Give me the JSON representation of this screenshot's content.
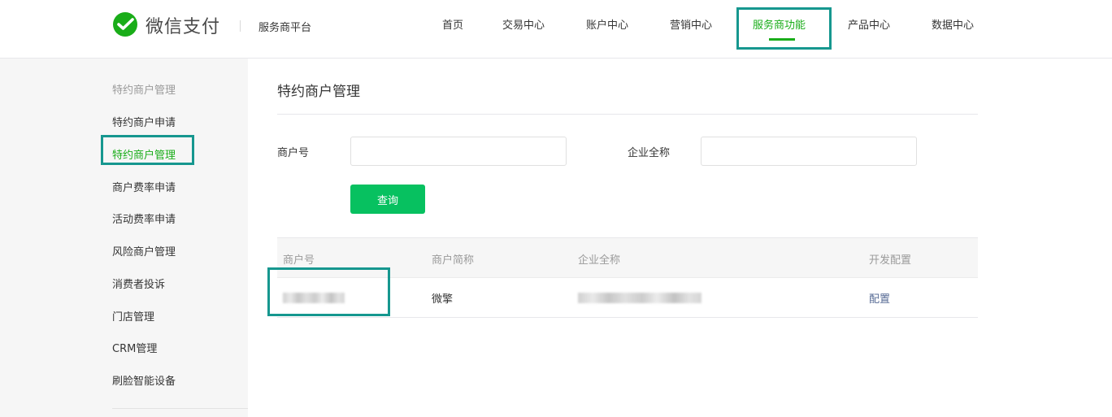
{
  "header": {
    "logo_text": "微信支付",
    "platform": "服务商平台",
    "nav": [
      "首页",
      "交易中心",
      "账户中心",
      "营销中心",
      "服务商功能",
      "产品中心",
      "数据中心"
    ],
    "active_nav": "服务商功能"
  },
  "sidebar": {
    "section_title": "特约商户管理",
    "items": [
      "特约商户申请",
      "特约商户管理",
      "商户费率申请",
      "活动费率申请",
      "风险商户管理",
      "消费者投诉",
      "门店管理",
      "CRM管理",
      "刷脸智能设备"
    ],
    "active_item": "特约商户管理"
  },
  "main": {
    "title": "特约商户管理",
    "form": {
      "merchant_no_label": "商户号",
      "merchant_no_value": "",
      "company_label": "企业全称",
      "company_value": "",
      "query_button": "查询"
    },
    "table": {
      "columns": [
        "商户号",
        "商户简称",
        "企业全称",
        "开发配置"
      ],
      "rows": [
        {
          "short_name": "微擎",
          "action": "配置"
        }
      ]
    }
  },
  "colors": {
    "brand_green": "#1aad19",
    "button_green": "#07c160",
    "highlight_box": "#16978f",
    "link": "#576b95"
  },
  "icons": {
    "logo": "wechat-pay-logo-icon"
  }
}
